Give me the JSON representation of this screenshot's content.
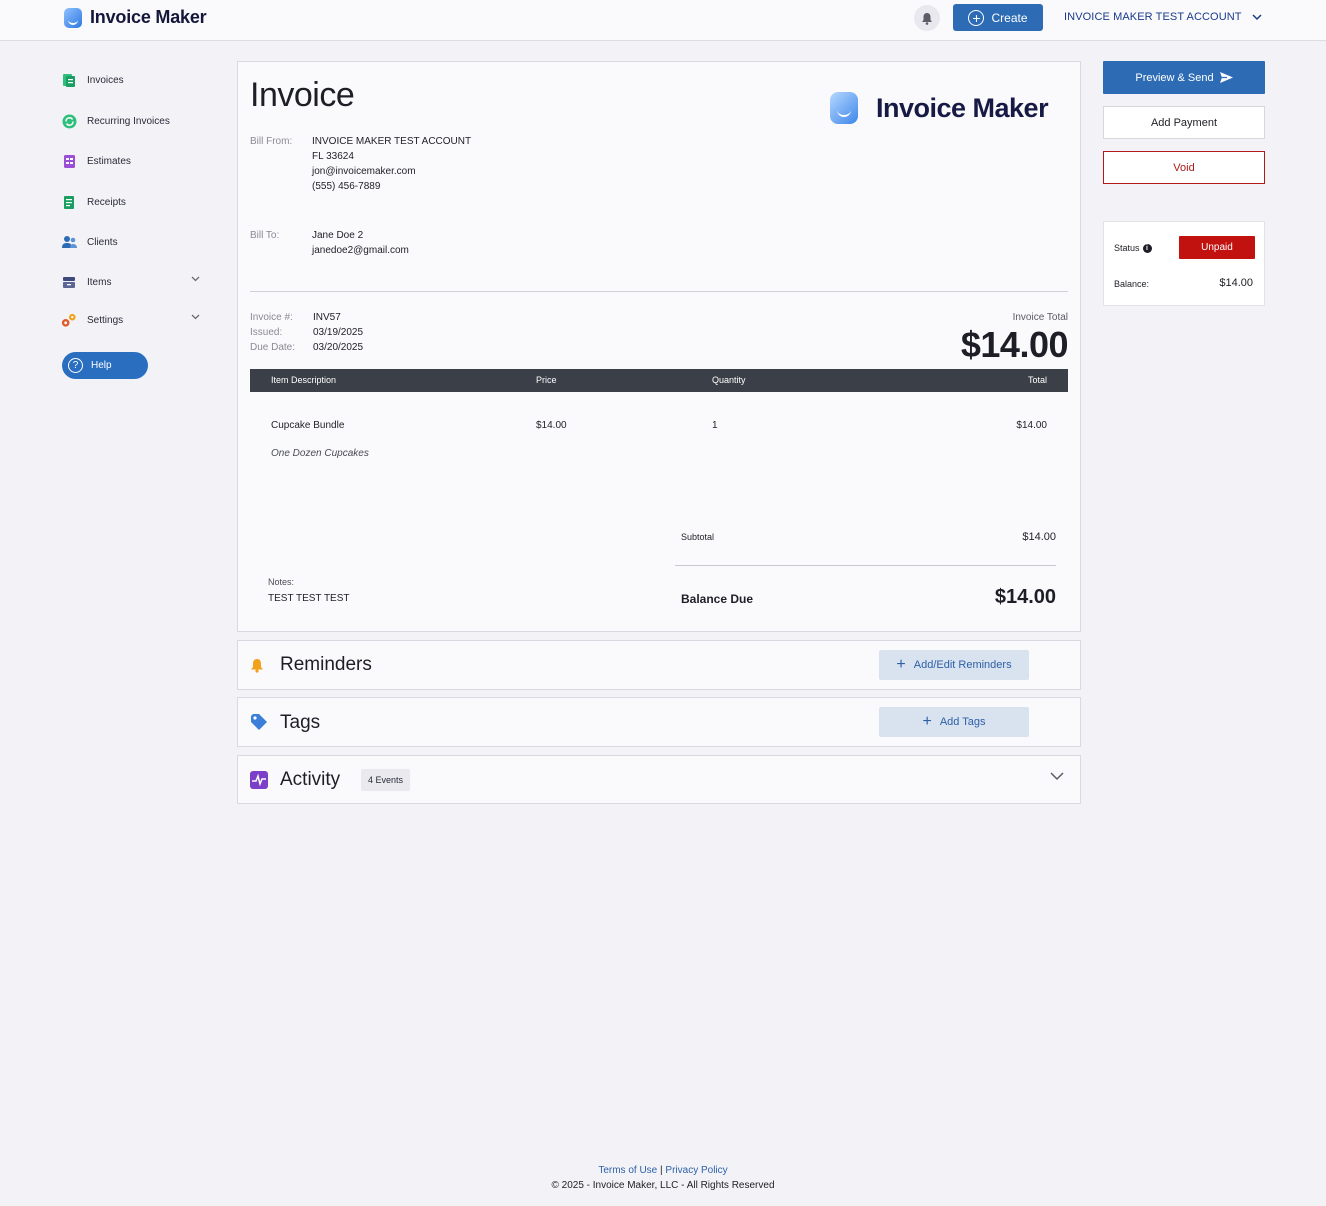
{
  "header": {
    "brand": "Invoice Maker",
    "create_label": "Create",
    "account_name": "INVOICE MAKER TEST ACCOUNT"
  },
  "sidebar": {
    "items": [
      {
        "label": "Invoices",
        "icon": "invoice-icon"
      },
      {
        "label": "Recurring Invoices",
        "icon": "recurring-icon"
      },
      {
        "label": "Estimates",
        "icon": "estimates-icon"
      },
      {
        "label": "Receipts",
        "icon": "receipts-icon"
      },
      {
        "label": "Clients",
        "icon": "clients-icon"
      },
      {
        "label": "Items",
        "icon": "items-icon"
      },
      {
        "label": "Settings",
        "icon": "settings-icon"
      }
    ],
    "help_label": "Help"
  },
  "invoice": {
    "title": "Invoice",
    "logo_text": "Invoice Maker",
    "bill_from_label": "Bill From:",
    "bill_from": {
      "name": "INVOICE MAKER TEST ACCOUNT",
      "address": "FL 33624",
      "email": "jon@invoicemaker.com",
      "phone": "(555) 456-7889"
    },
    "bill_to_label": "Bill To:",
    "bill_to": {
      "name": "Jane Doe 2",
      "email": "janedoe2@gmail.com"
    },
    "number_label": "Invoice #:",
    "number": "INV57",
    "issued_label": "Issued:",
    "issued": "03/19/2025",
    "due_label": "Due Date:",
    "due": "03/20/2025",
    "total_caption": "Invoice Total",
    "total": "$14.00",
    "table": {
      "headers": [
        "Item Description",
        "Price",
        "Quantity",
        "Total"
      ],
      "rows": [
        {
          "description": "Cupcake Bundle",
          "price": "$14.00",
          "quantity": "1",
          "total": "$14.00",
          "details": "One Dozen Cupcakes"
        }
      ]
    },
    "subtotal_label": "Subtotal",
    "subtotal": "$14.00",
    "notes_label": "Notes:",
    "notes": "TEST TEST TEST",
    "balance_due_label": "Balance Due",
    "balance_due": "$14.00"
  },
  "sections": {
    "reminders": {
      "title": "Reminders",
      "button": "Add/Edit Reminders"
    },
    "tags": {
      "title": "Tags",
      "button": "Add Tags"
    },
    "activity": {
      "title": "Activity",
      "badge": "4 Events"
    }
  },
  "actions": {
    "preview_send": "Preview & Send",
    "add_payment": "Add Payment",
    "void": "Void"
  },
  "status_panel": {
    "status_label": "Status",
    "status_value": "Unpaid",
    "balance_label": "Balance:",
    "balance_value": "$14.00"
  },
  "footer": {
    "terms": "Terms of Use",
    "separator": "|",
    "privacy": "Privacy Policy",
    "copyright": "© 2025 - Invoice Maker, LLC - All Rights Reserved"
  },
  "colors": {
    "primary": "#2d6cb5",
    "danger": "#c2120f",
    "table_header": "#3b3f48",
    "background": "#f3f3f7"
  }
}
